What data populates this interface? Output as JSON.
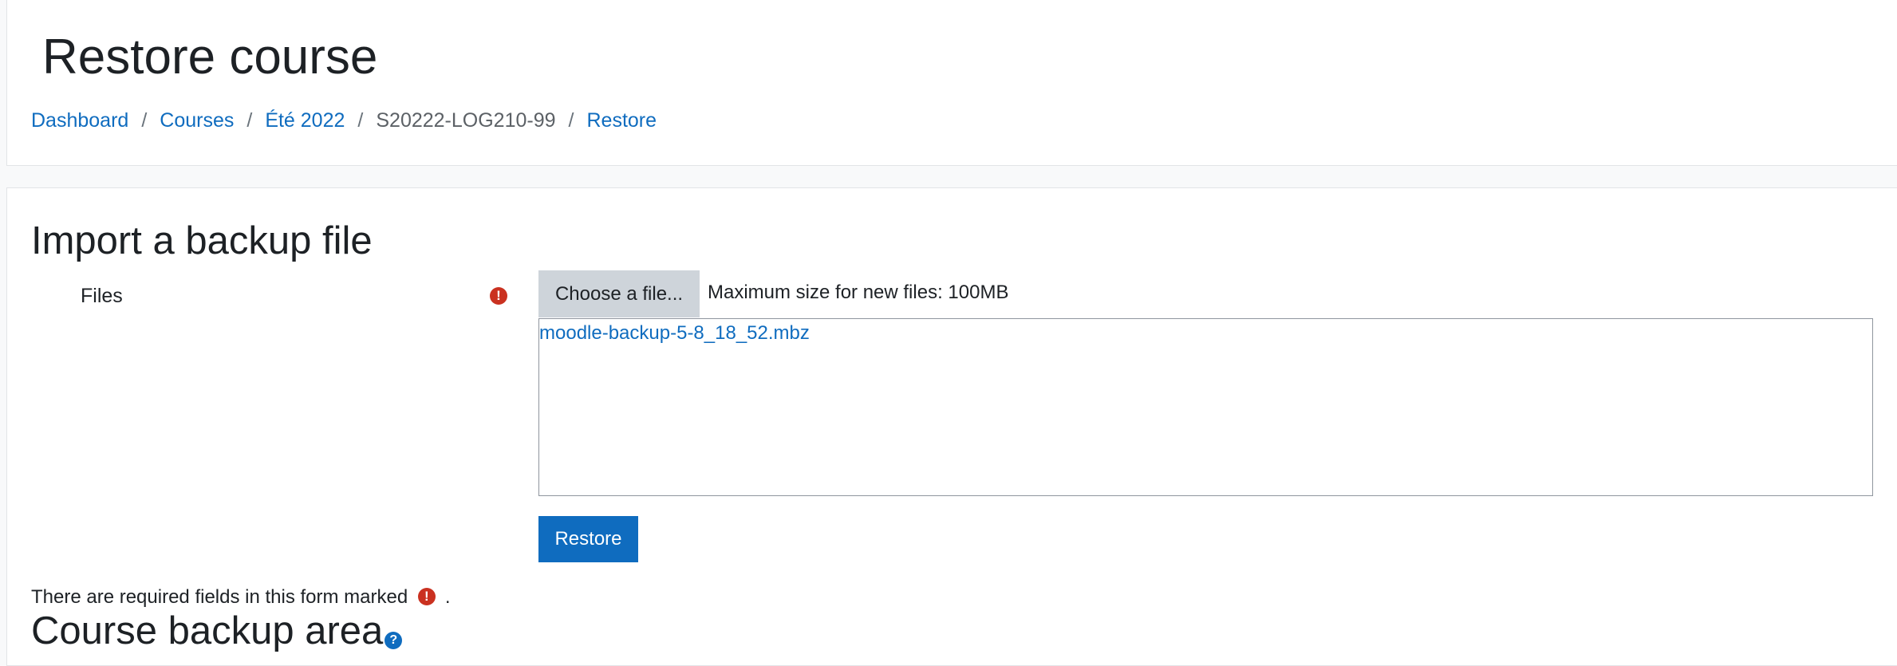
{
  "header": {
    "title": "Restore course",
    "breadcrumb": [
      {
        "label": "Dashboard",
        "link": true
      },
      {
        "label": "Courses",
        "link": true
      },
      {
        "label": "Été 2022",
        "link": true
      },
      {
        "label": "S20222-LOG210-99",
        "link": false
      },
      {
        "label": "Restore",
        "link": true
      }
    ],
    "separator": "/"
  },
  "import": {
    "title": "Import a backup file",
    "files_label": "Files",
    "required_icon": "!",
    "choose_button": "Choose a file...",
    "max_size_text": "Maximum size for new files: 100MB",
    "file_name": "moodle-backup-5-8_18_52.mbz",
    "restore_button": "Restore",
    "required_note_prefix": "There are required fields in this form marked",
    "required_note_suffix": "."
  },
  "backup_area": {
    "title": "Course backup area",
    "help_icon": "?"
  },
  "colors": {
    "link": "#0f6cbf",
    "primary_button": "#0f6cbf",
    "required": "#ca3120",
    "secondary_button": "#ced4da"
  }
}
